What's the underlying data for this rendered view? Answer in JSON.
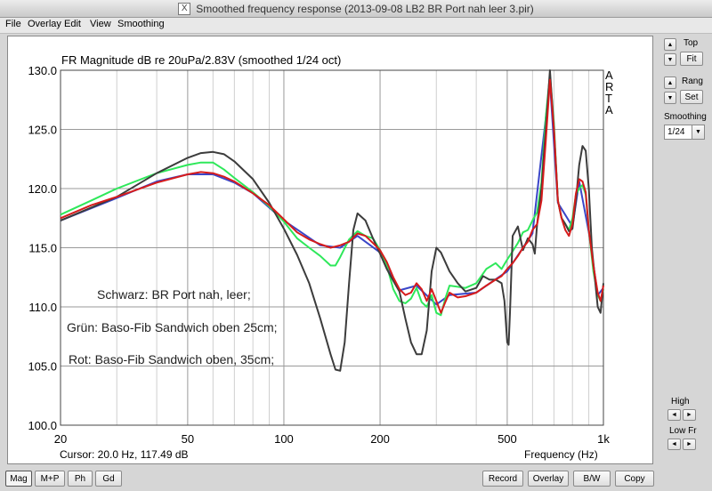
{
  "window": {
    "title": "Smoothed frequency response (2013-09-08 LB2 BR Port nah leer 3.pir)",
    "icon": "x-window-icon"
  },
  "menu": [
    "File",
    "Overlay",
    "Edit",
    "View",
    "Smoothing"
  ],
  "plot": {
    "cursor_text": "Cursor: 20.0 Hz, 117.49 dB",
    "watermark": [
      "A",
      "R",
      "T",
      "A"
    ],
    "annotations": [
      "Schwarz: BR Port nah, leer;",
      "Grün: Baso-Fib Sandwich oben 25cm;",
      "Rot: Baso-Fib Sandwich oben, 35cm;"
    ]
  },
  "chart_data": {
    "type": "line",
    "title": "FR Magnitude dB re 20uPa/2.83V (smoothed 1/24 oct)",
    "xlabel": "Frequency (Hz)",
    "ylabel": "",
    "xscale": "log",
    "xlim": [
      20,
      1000
    ],
    "ylim": [
      100,
      130
    ],
    "x_ticks": [
      20,
      50,
      100,
      200,
      500,
      1000
    ],
    "x_tick_labels": [
      "20",
      "50",
      "100",
      "200",
      "500",
      "1k"
    ],
    "y_ticks": [
      100,
      105,
      110,
      115,
      120,
      125,
      130
    ],
    "y_tick_labels": [
      "100.0",
      "105.0",
      "110.0",
      "115.0",
      "120.0",
      "125.0",
      "130.0"
    ],
    "grid": true,
    "legend": "none",
    "series": [
      {
        "color": "#3c3c3c",
        "points": [
          [
            20,
            117.3
          ],
          [
            30,
            119.3
          ],
          [
            40,
            121.3
          ],
          [
            50,
            122.6
          ],
          [
            55,
            123.0
          ],
          [
            60,
            123.1
          ],
          [
            65,
            122.9
          ],
          [
            70,
            122.3
          ],
          [
            80,
            120.8
          ],
          [
            90,
            118.8
          ],
          [
            100,
            116.6
          ],
          [
            110,
            114.4
          ],
          [
            120,
            112.0
          ],
          [
            130,
            109.0
          ],
          [
            140,
            106.0
          ],
          [
            145,
            104.7
          ],
          [
            150,
            104.6
          ],
          [
            155,
            107.0
          ],
          [
            160,
            112.0
          ],
          [
            165,
            116.5
          ],
          [
            170,
            117.9
          ],
          [
            180,
            117.3
          ],
          [
            190,
            115.8
          ],
          [
            200,
            114.5
          ],
          [
            210,
            113.2
          ],
          [
            220,
            112.2
          ],
          [
            230,
            111.3
          ],
          [
            240,
            109.0
          ],
          [
            250,
            107.0
          ],
          [
            260,
            106.0
          ],
          [
            270,
            106.0
          ],
          [
            280,
            108.0
          ],
          [
            290,
            113.0
          ],
          [
            300,
            115.0
          ],
          [
            310,
            114.6
          ],
          [
            330,
            113.0
          ],
          [
            350,
            112.0
          ],
          [
            370,
            111.3
          ],
          [
            400,
            111.6
          ],
          [
            420,
            112.6
          ],
          [
            440,
            112.3
          ],
          [
            460,
            112.3
          ],
          [
            480,
            112.0
          ],
          [
            490,
            110.5
          ],
          [
            500,
            107.0
          ],
          [
            505,
            106.8
          ],
          [
            510,
            109.5
          ],
          [
            520,
            116.0
          ],
          [
            540,
            116.8
          ],
          [
            560,
            114.8
          ],
          [
            580,
            115.8
          ],
          [
            600,
            115.3
          ],
          [
            610,
            114.5
          ],
          [
            620,
            117.0
          ],
          [
            640,
            120.0
          ],
          [
            660,
            125.0
          ],
          [
            680,
            130.0
          ],
          [
            700,
            125.0
          ],
          [
            720,
            119.0
          ],
          [
            740,
            117.5
          ],
          [
            760,
            117.0
          ],
          [
            780,
            116.4
          ],
          [
            800,
            116.6
          ],
          [
            820,
            119.0
          ],
          [
            840,
            122.0
          ],
          [
            860,
            123.6
          ],
          [
            880,
            123.2
          ],
          [
            900,
            120.0
          ],
          [
            920,
            115.0
          ],
          [
            960,
            110.0
          ],
          [
            980,
            109.5
          ],
          [
            1000,
            112.0
          ]
        ]
      },
      {
        "color": "#2ee85a",
        "points": [
          [
            20,
            117.8
          ],
          [
            25,
            119.0
          ],
          [
            30,
            120.0
          ],
          [
            40,
            121.3
          ],
          [
            50,
            122.0
          ],
          [
            55,
            122.2
          ],
          [
            60,
            122.2
          ],
          [
            65,
            121.6
          ],
          [
            70,
            120.9
          ],
          [
            80,
            119.7
          ],
          [
            90,
            118.5
          ],
          [
            100,
            117.2
          ],
          [
            110,
            115.8
          ],
          [
            120,
            115.0
          ],
          [
            130,
            114.3
          ],
          [
            140,
            113.5
          ],
          [
            145,
            113.5
          ],
          [
            150,
            114.2
          ],
          [
            160,
            115.7
          ],
          [
            170,
            116.4
          ],
          [
            180,
            116.0
          ],
          [
            190,
            115.8
          ],
          [
            200,
            114.8
          ],
          [
            210,
            113.5
          ],
          [
            220,
            111.5
          ],
          [
            230,
            110.5
          ],
          [
            240,
            110.3
          ],
          [
            250,
            110.7
          ],
          [
            260,
            111.6
          ],
          [
            270,
            110.4
          ],
          [
            280,
            110.0
          ],
          [
            290,
            111.0
          ],
          [
            300,
            109.5
          ],
          [
            310,
            109.3
          ],
          [
            320,
            110.7
          ],
          [
            330,
            111.8
          ],
          [
            350,
            111.7
          ],
          [
            370,
            111.6
          ],
          [
            400,
            112.0
          ],
          [
            430,
            113.2
          ],
          [
            460,
            113.7
          ],
          [
            480,
            113.2
          ],
          [
            500,
            114.0
          ],
          [
            520,
            114.7
          ],
          [
            540,
            115.4
          ],
          [
            560,
            116.3
          ],
          [
            580,
            116.5
          ],
          [
            600,
            117.3
          ],
          [
            620,
            118.0
          ],
          [
            640,
            120.5
          ],
          [
            660,
            126.0
          ],
          [
            680,
            129.6
          ],
          [
            700,
            125.5
          ],
          [
            720,
            119.0
          ],
          [
            740,
            117.5
          ],
          [
            760,
            117.0
          ],
          [
            780,
            116.5
          ],
          [
            800,
            117.5
          ],
          [
            820,
            119.5
          ],
          [
            840,
            120.0
          ],
          [
            860,
            120.3
          ],
          [
            880,
            119.5
          ],
          [
            900,
            116.5
          ],
          [
            930,
            113.0
          ],
          [
            960,
            111.0
          ],
          [
            980,
            110.5
          ],
          [
            1000,
            111.5
          ]
        ]
      },
      {
        "color": "#d61b1b",
        "points": [
          [
            20,
            117.5
          ],
          [
            25,
            118.6
          ],
          [
            30,
            119.3
          ],
          [
            40,
            120.5
          ],
          [
            50,
            121.2
          ],
          [
            55,
            121.4
          ],
          [
            60,
            121.3
          ],
          [
            65,
            121.0
          ],
          [
            70,
            120.6
          ],
          [
            80,
            119.6
          ],
          [
            90,
            118.6
          ],
          [
            100,
            117.4
          ],
          [
            110,
            116.3
          ],
          [
            120,
            115.7
          ],
          [
            130,
            115.3
          ],
          [
            140,
            115.0
          ],
          [
            150,
            115.2
          ],
          [
            160,
            115.5
          ],
          [
            170,
            116.2
          ],
          [
            180,
            116.0
          ],
          [
            190,
            115.4
          ],
          [
            200,
            114.8
          ],
          [
            210,
            113.8
          ],
          [
            220,
            112.5
          ],
          [
            230,
            111.5
          ],
          [
            240,
            111.0
          ],
          [
            250,
            111.2
          ],
          [
            260,
            112.0
          ],
          [
            270,
            111.5
          ],
          [
            280,
            110.5
          ],
          [
            290,
            111.5
          ],
          [
            300,
            110.5
          ],
          [
            310,
            109.5
          ],
          [
            320,
            110.4
          ],
          [
            330,
            111.2
          ],
          [
            350,
            110.8
          ],
          [
            370,
            110.9
          ],
          [
            400,
            111.2
          ],
          [
            430,
            111.8
          ],
          [
            460,
            112.3
          ],
          [
            480,
            112.6
          ],
          [
            500,
            113.2
          ],
          [
            520,
            113.7
          ],
          [
            540,
            114.3
          ],
          [
            560,
            115.0
          ],
          [
            580,
            115.5
          ],
          [
            600,
            116.5
          ],
          [
            620,
            117.0
          ],
          [
            640,
            119.0
          ],
          [
            660,
            124.0
          ],
          [
            680,
            129.2
          ],
          [
            700,
            125.0
          ],
          [
            720,
            119.0
          ],
          [
            740,
            117.5
          ],
          [
            760,
            116.5
          ],
          [
            780,
            116.0
          ],
          [
            800,
            117.0
          ],
          [
            820,
            119.6
          ],
          [
            840,
            120.8
          ],
          [
            860,
            120.6
          ],
          [
            880,
            119.7
          ],
          [
            900,
            116.5
          ],
          [
            930,
            113.5
          ],
          [
            960,
            111.2
          ],
          [
            980,
            110.5
          ],
          [
            1000,
            111.8
          ]
        ]
      },
      {
        "color": "#3a46c8",
        "points": [
          [
            20,
            117.3
          ],
          [
            30,
            119.2
          ],
          [
            40,
            120.6
          ],
          [
            50,
            121.2
          ],
          [
            60,
            121.2
          ],
          [
            70,
            120.5
          ],
          [
            80,
            119.6
          ],
          [
            100,
            117.3
          ],
          [
            130,
            115.2
          ],
          [
            150,
            115.0
          ],
          [
            170,
            116.0
          ],
          [
            200,
            114.6
          ],
          [
            230,
            111.4
          ],
          [
            260,
            111.8
          ],
          [
            300,
            110.2
          ],
          [
            330,
            111.0
          ],
          [
            400,
            111.2
          ],
          [
            500,
            113.0
          ],
          [
            600,
            116.2
          ],
          [
            680,
            129.0
          ],
          [
            720,
            118.8
          ],
          [
            800,
            116.8
          ],
          [
            840,
            120.6
          ],
          [
            900,
            116.3
          ],
          [
            960,
            111.0
          ],
          [
            1000,
            111.6
          ]
        ]
      }
    ]
  },
  "right_panel": {
    "top_label": "Top",
    "fit_label": "Fit",
    "range_label": "Rang",
    "set_label": "Set",
    "smoothing_label": "Smoothing",
    "smoothing_value": "1/24",
    "high_label": "High",
    "lowfr_label": "Low Fr",
    "up_arrow": "▲",
    "down_arrow": "▼",
    "left_arrow": "◄",
    "right_arrow": "►"
  },
  "bottom_buttons": {
    "mag": "Mag",
    "mp": "M+P",
    "ph": "Ph",
    "gd": "Gd",
    "record": "Record",
    "overlay": "Overlay",
    "bw": "B/W",
    "copy": "Copy"
  }
}
